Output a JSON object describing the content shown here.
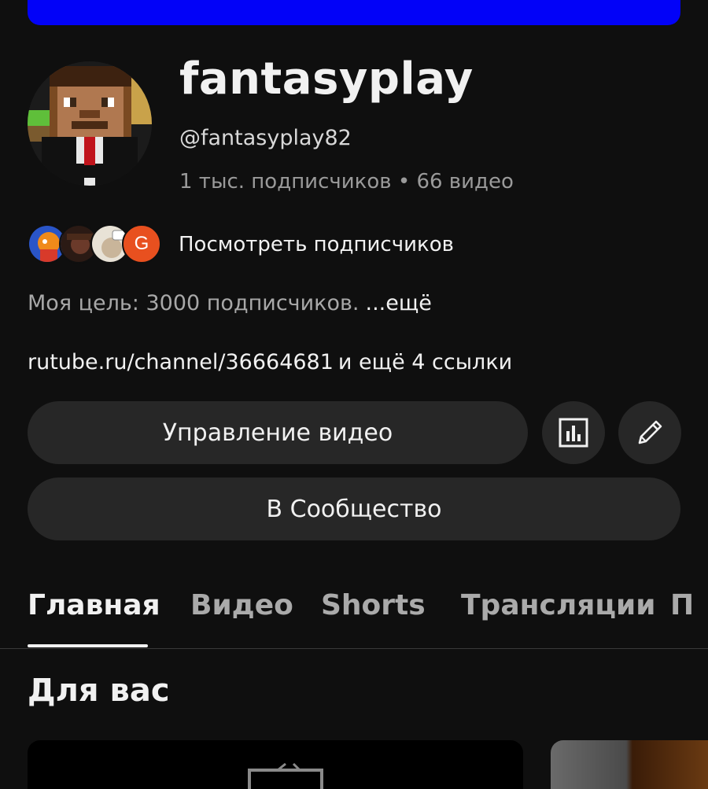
{
  "channel": {
    "name": "fantasyplay",
    "handle": "@fantasyplay82",
    "stats": "1 тыс. подписчиков • 66 видео"
  },
  "subscribers": {
    "view_label": "Посмотреть подписчиков",
    "mini_avatar_letter": "G"
  },
  "description": {
    "text": "Моя цель: 3000 подписчиков.",
    "more_label": "...ещё"
  },
  "links": {
    "primary": "rutube.ru/channel/36664681",
    "extra": "и ещё 4 ссылки"
  },
  "buttons": {
    "manage_videos": "Управление видео",
    "analytics_icon": "bar-chart-icon",
    "edit_icon": "pencil-icon",
    "community": "В Сообщество"
  },
  "tabs": [
    {
      "label": "Главная",
      "active": true
    },
    {
      "label": "Видео",
      "active": false
    },
    {
      "label": "Shorts",
      "active": false
    },
    {
      "label": "Трансляции",
      "active": false
    },
    {
      "label": "П",
      "active": false
    }
  ],
  "section": {
    "title": "Для вас"
  },
  "colors": {
    "banner": "#0202f8",
    "background": "#0f0f0f",
    "button": "#272727",
    "mini_avatar_g": "#e8501f"
  }
}
